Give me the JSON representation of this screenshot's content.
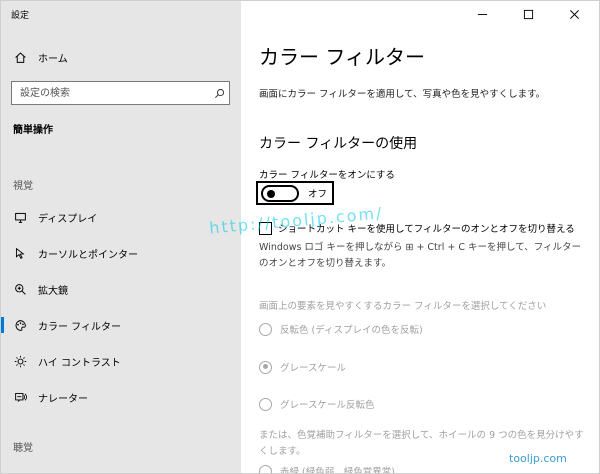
{
  "window": {
    "title": "設定"
  },
  "sidebar": {
    "home_label": "ホーム",
    "search_placeholder": "設定の検索",
    "section_title": "簡単操作",
    "group_vision": "視覚",
    "group_hearing": "聴覚",
    "items": [
      {
        "label": "ディスプレイ",
        "icon": "monitor-icon"
      },
      {
        "label": "カーソルとポインター",
        "icon": "cursor-icon"
      },
      {
        "label": "拡大鏡",
        "icon": "magnifier-icon"
      },
      {
        "label": "カラー フィルター",
        "icon": "palette-icon",
        "active": true
      },
      {
        "label": "ハイ コントラスト",
        "icon": "brightness-icon"
      },
      {
        "label": "ナレーター",
        "icon": "narrator-icon"
      }
    ]
  },
  "main": {
    "title": "カラー フィルター",
    "description": "画面にカラー フィルターを適用して、写真や色を見やすくします。",
    "section_title": "カラー フィルターの使用",
    "toggle_label": "カラー フィルターをオンにする",
    "toggle_state": "オフ",
    "checkbox_label": "ショートカット キーを使用してフィルターのオンとオフを切り替える",
    "help_text": "Windows ロゴ キーを押しながら ⊞ + Ctrl + C キーを押して、フィルターのオンとオフを切り替えます。",
    "select_label": "画面上の要素を見やすくするカラー フィルターを選択してください",
    "options": [
      {
        "label": "反転色 (ディスプレイの色を反転)",
        "selected": false
      },
      {
        "label": "グレースケール",
        "selected": true
      },
      {
        "label": "グレースケール反転色",
        "selected": false
      }
    ],
    "bottom_text": "または、色覚補助フィルターを選択して、ホイールの 9 つの色を見分けやすくします。",
    "cut_option": "赤緑 (緑色弱、緑色覚異常)"
  },
  "watermark": {
    "text": "http://tooljp.com/",
    "corner_text": "tooljp.com"
  },
  "colors": {
    "accent": "#0078d7",
    "sidebar_bg": "#e6e6e6",
    "disabled_text": "#a0a0a0"
  }
}
